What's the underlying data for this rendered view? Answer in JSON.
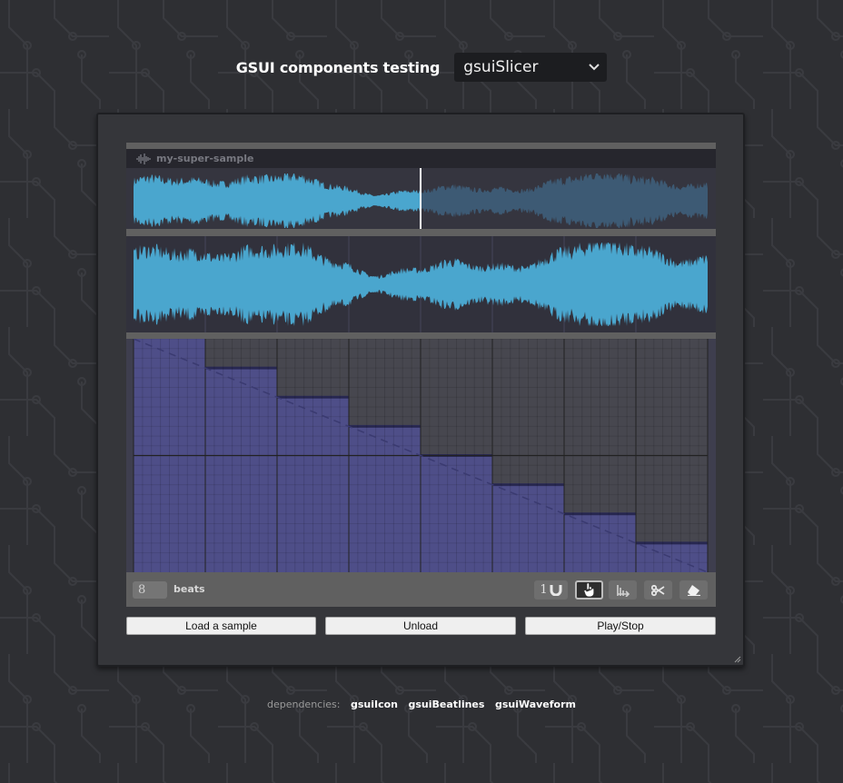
{
  "header": {
    "title": "GSUI components testing",
    "selected_component": "gsuiSlicer"
  },
  "slicer": {
    "sample_name": "my-super-sample",
    "beats_value": "8",
    "beats_label": "beats",
    "magnet_value": "1",
    "playhead_fraction": 0.5,
    "slices_count": 8,
    "tools": [
      "magnet-icon",
      "hand-pointer-icon",
      "slice-arrow-icon",
      "scissors-icon",
      "eraser-icon"
    ],
    "active_tool": "hand-pointer-icon",
    "colors": {
      "wave": "#4aa6ce",
      "wave_dim": "#3d5a74",
      "slice_fill": "#4e4e88",
      "slice_empty": "#47474f"
    }
  },
  "buttons": {
    "load": "Load a sample",
    "unload": "Unload",
    "play_stop": "Play/Stop"
  },
  "footer": {
    "label": "dependencies:",
    "deps": [
      "gsuiIcon",
      "gsuiBeatlines",
      "gsuiWaveform"
    ]
  }
}
